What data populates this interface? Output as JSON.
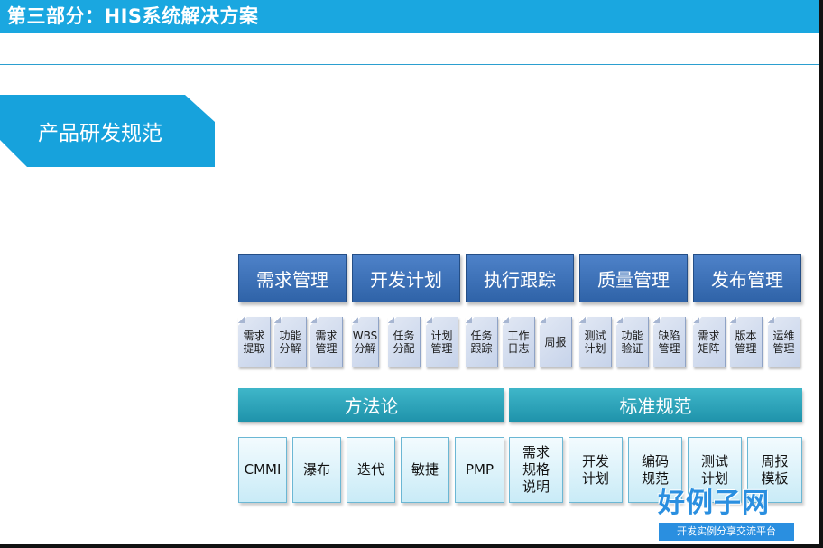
{
  "header": {
    "title": "第三部分：HIS系统解决方案"
  },
  "section": {
    "title": "产品研发规范"
  },
  "categories": [
    "需求管理",
    "开发计划",
    "执行跟踪",
    "质量管理",
    "发布管理"
  ],
  "sub_items": [
    "需求提取",
    "功能分解",
    "需求管理",
    "WBS分解",
    "任务分配",
    "计划管理",
    "任务跟踪",
    "工作日志",
    "周报",
    "测试计划",
    "功能验证",
    "缺陷管理",
    "需求矩阵",
    "版本管理",
    "运维管理"
  ],
  "bars": [
    "方法论",
    "标准规范"
  ],
  "methodology": [
    "CMMI",
    "瀑布",
    "迭代",
    "敏捷",
    "PMP"
  ],
  "standards": [
    "需求规格说明",
    "开发计划",
    "编码规范",
    "测试计划",
    "周报模板"
  ],
  "logo": {
    "main": "好例子网",
    "sub": "开发实例分享交流平台"
  },
  "colors": {
    "header": "#1aa7e0",
    "category": "#3a6fb5",
    "bar": "#2ba6bd",
    "bottom": "#dff3fb"
  }
}
